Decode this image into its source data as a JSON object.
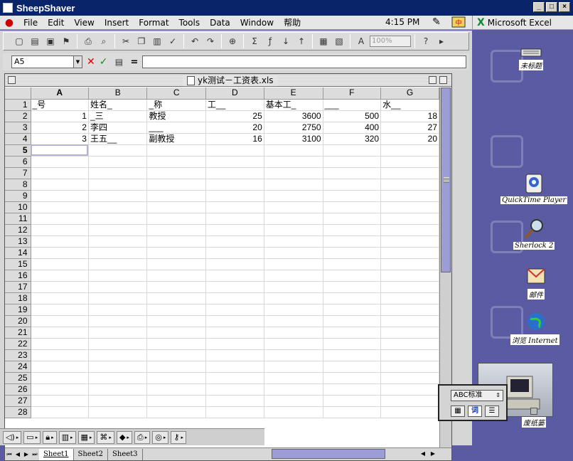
{
  "window": {
    "title": "SheepShaver"
  },
  "menubar": {
    "items": [
      "File",
      "Edit",
      "View",
      "Insert",
      "Format",
      "Tools",
      "Data",
      "Window",
      "帮助"
    ],
    "clock": "4:15 PM",
    "app_name": "Microsoft Excel"
  },
  "formula_bar": {
    "name_box": "A5",
    "formula": ""
  },
  "toolbar": {
    "zoom": "100%"
  },
  "document": {
    "title": "yk测试－工资表.xls"
  },
  "sheet": {
    "columns": [
      "A",
      "B",
      "C",
      "D",
      "E",
      "F",
      "G"
    ],
    "row_numbers": [
      "1",
      "2",
      "3",
      "4",
      "5",
      "6",
      "7",
      "8",
      "9",
      "10",
      "11",
      "12",
      "13",
      "14",
      "15",
      "16",
      "17",
      "18",
      "19",
      "20",
      "21",
      "22",
      "23",
      "24",
      "25",
      "26",
      "27",
      "28"
    ],
    "rows": [
      [
        "_号",
        "姓名_",
        "_称",
        "工__",
        "基本工_",
        "___",
        "水__"
      ],
      [
        "1",
        "_三",
        "教授",
        "25",
        "3600",
        "500",
        "18"
      ],
      [
        "2",
        "李四",
        "___",
        "20",
        "2750",
        "400",
        "27"
      ],
      [
        "3",
        "王五__",
        "副教授",
        "16",
        "3100",
        "320",
        "20"
      ]
    ],
    "active_cell": "A5",
    "tabs": [
      "Sheet1",
      "Sheet2",
      "Sheet3"
    ]
  },
  "desktop": {
    "icons": [
      {
        "label": "未标题",
        "icon": "keyboard-icon"
      },
      {
        "label": "QuickTime Player",
        "icon": "quicktime-icon"
      },
      {
        "label": "Sherlock 2",
        "icon": "sherlock-icon"
      },
      {
        "label": "邮件",
        "icon": "mail-icon"
      },
      {
        "label": "浏览 Internet",
        "icon": "browser-icon"
      },
      {
        "label": "废纸篓",
        "icon": "trash-icon"
      }
    ]
  },
  "ime": {
    "mode": "ABC标准",
    "word_button": "词"
  },
  "colors": {
    "titlebar": "#0a246a",
    "desktop": "#5b5ba3",
    "scroll_thumb": "#9c9cd6",
    "excel_x": "#118833"
  }
}
